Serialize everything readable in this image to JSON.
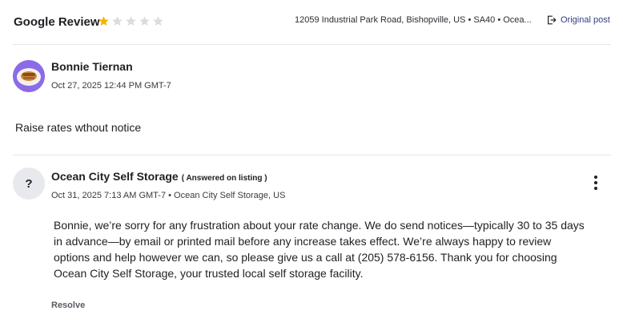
{
  "header": {
    "title": "Google Review",
    "rating": 1,
    "max_rating": 5,
    "star_filled_color": "#f4b400",
    "star_empty_color": "#dadce0",
    "location": "12059 Industrial Park Road, Bishopville, US • SA40 • Ocea...",
    "original_post_label": "Original post",
    "original_post_icon": "open-external-icon"
  },
  "review": {
    "author": "Bonnie Tiernan",
    "date": "Oct 27, 2025 12:44 PM GMT-7",
    "text": "Raise rates wthout notice"
  },
  "reply": {
    "avatar_symbol": "?",
    "author": "Ocean City Self Storage",
    "status": "( Answered on listing )",
    "meta": "Oct 31, 2025 7:13 AM GMT-7 • Ocean City Self Storage, US",
    "text": "Bonnie, we’re sorry for any frustration about your rate change. We do send notices—typically 30 to 35 days in advance—by email or printed mail before any increase takes effect. We’re always happy to review options and help however we can, so please give us a call at (205) 578-6156. Thank you for choosing Ocean City Self Storage, your trusted local self storage facility.",
    "resolve_label": "Resolve",
    "menu_icon": "more-vertical-icon"
  }
}
